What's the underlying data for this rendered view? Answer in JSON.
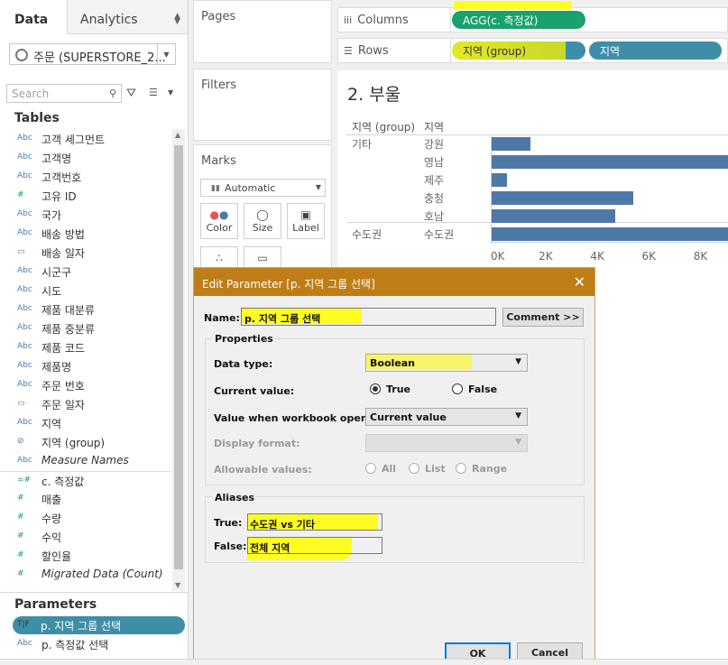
{
  "left_pane": {
    "tab_data": "Data",
    "tab_analytics": "Analytics",
    "datasource": "주문 (SUPERSTORE_2...",
    "search_placeholder": "Search",
    "tables_title": "Tables",
    "fields": [
      {
        "type": "Abc",
        "name": "고객 세그먼트"
      },
      {
        "type": "Abc",
        "name": "고객명"
      },
      {
        "type": "Abc",
        "name": "고객번호"
      },
      {
        "type": "#",
        "name": "고유 ID"
      },
      {
        "type": "Abc",
        "name": "국가"
      },
      {
        "type": "Abc",
        "name": "배송 방법"
      },
      {
        "type": "cal",
        "name": "배송 일자"
      },
      {
        "type": "Abc",
        "name": "시군구"
      },
      {
        "type": "Abc",
        "name": "시도"
      },
      {
        "type": "Abc",
        "name": "제품 대분류"
      },
      {
        "type": "Abc",
        "name": "제품 중분류"
      },
      {
        "type": "Abc",
        "name": "제품 코드"
      },
      {
        "type": "Abc",
        "name": "제품명"
      },
      {
        "type": "Abc",
        "name": "주문 번호"
      },
      {
        "type": "cal",
        "name": "주문 일자"
      },
      {
        "type": "Abc",
        "name": "지역"
      },
      {
        "type": "clip",
        "name": "지역 (group)"
      },
      {
        "type": "Abc",
        "name": "Measure Names"
      },
      {
        "type": "=#",
        "name": "c. 측정값"
      },
      {
        "type": "#",
        "name": "매출"
      },
      {
        "type": "#",
        "name": "수량"
      },
      {
        "type": "#",
        "name": "수익"
      },
      {
        "type": "#",
        "name": "할인율"
      },
      {
        "type": "#",
        "name": "Migrated Data (Count)"
      }
    ],
    "parameters_title": "Parameters",
    "param_selected_type": "T|F",
    "param_selected": "p. 지역 그룹 선택",
    "param_2_type": "Abc",
    "param_2": "p. 측정값 선택"
  },
  "cards": {
    "pages": "Pages",
    "filters": "Filters",
    "marks": "Marks",
    "marks_type": "Automatic",
    "color": "Color",
    "size": "Size",
    "label": "Label"
  },
  "shelves": {
    "columns_label": "Columns",
    "rows_label": "Rows",
    "columns_pill": "AGG(c. 측정값)",
    "rows_pill_1": "지역 (group)",
    "rows_pill_2": "지역"
  },
  "viz": {
    "title": "2. 부울",
    "header_group": "지역 (group)",
    "header_region": "지역",
    "groups": [
      {
        "name": "기타",
        "regions": [
          "강원",
          "영남",
          "제주",
          "충청",
          "호남"
        ]
      },
      {
        "name": "수도권",
        "regions": [
          "수도권"
        ]
      }
    ]
  },
  "chart_data": {
    "type": "bar",
    "categories": [
      "강원",
      "영남",
      "제주",
      "충청",
      "호남",
      "수도권"
    ],
    "values": [
      1500,
      9500,
      600,
      5500,
      4800,
      9500
    ],
    "xlim": [
      0,
      9200
    ],
    "ticks": [
      "0K",
      "2K",
      "4K",
      "6K",
      "8K"
    ],
    "tick_values": [
      0,
      2000,
      4000,
      6000,
      8000
    ],
    "bar_color": "#4e79a7"
  },
  "dialog": {
    "title": "Edit Parameter [p. 지역 그룹 선택]",
    "name_label": "Name:",
    "name_value": "p. 지역 그룹 선택",
    "comment_button": "Comment >>",
    "properties_title": "Properties",
    "data_type_label": "Data type:",
    "data_type_value": "Boolean",
    "current_value_label": "Current value:",
    "radio_true": "True",
    "radio_false": "False",
    "workbook_opens_label": "Value when workbook opens:",
    "workbook_opens_value": "Current value",
    "display_format_label": "Display format:",
    "allowable_label": "Allowable values:",
    "allow_all": "All",
    "allow_list": "List",
    "allow_range": "Range",
    "aliases_title": "Aliases",
    "true_label": "True:",
    "true_alias": "수도권 vs 기타",
    "false_label": "False:",
    "false_alias": "전체 지역",
    "ok": "OK",
    "cancel": "Cancel"
  },
  "colors": {
    "titlebar": "#be7d16",
    "green_pill": "#1aa16e",
    "blue_pill": "#3f8ea8",
    "highlight": "#ffff00"
  }
}
